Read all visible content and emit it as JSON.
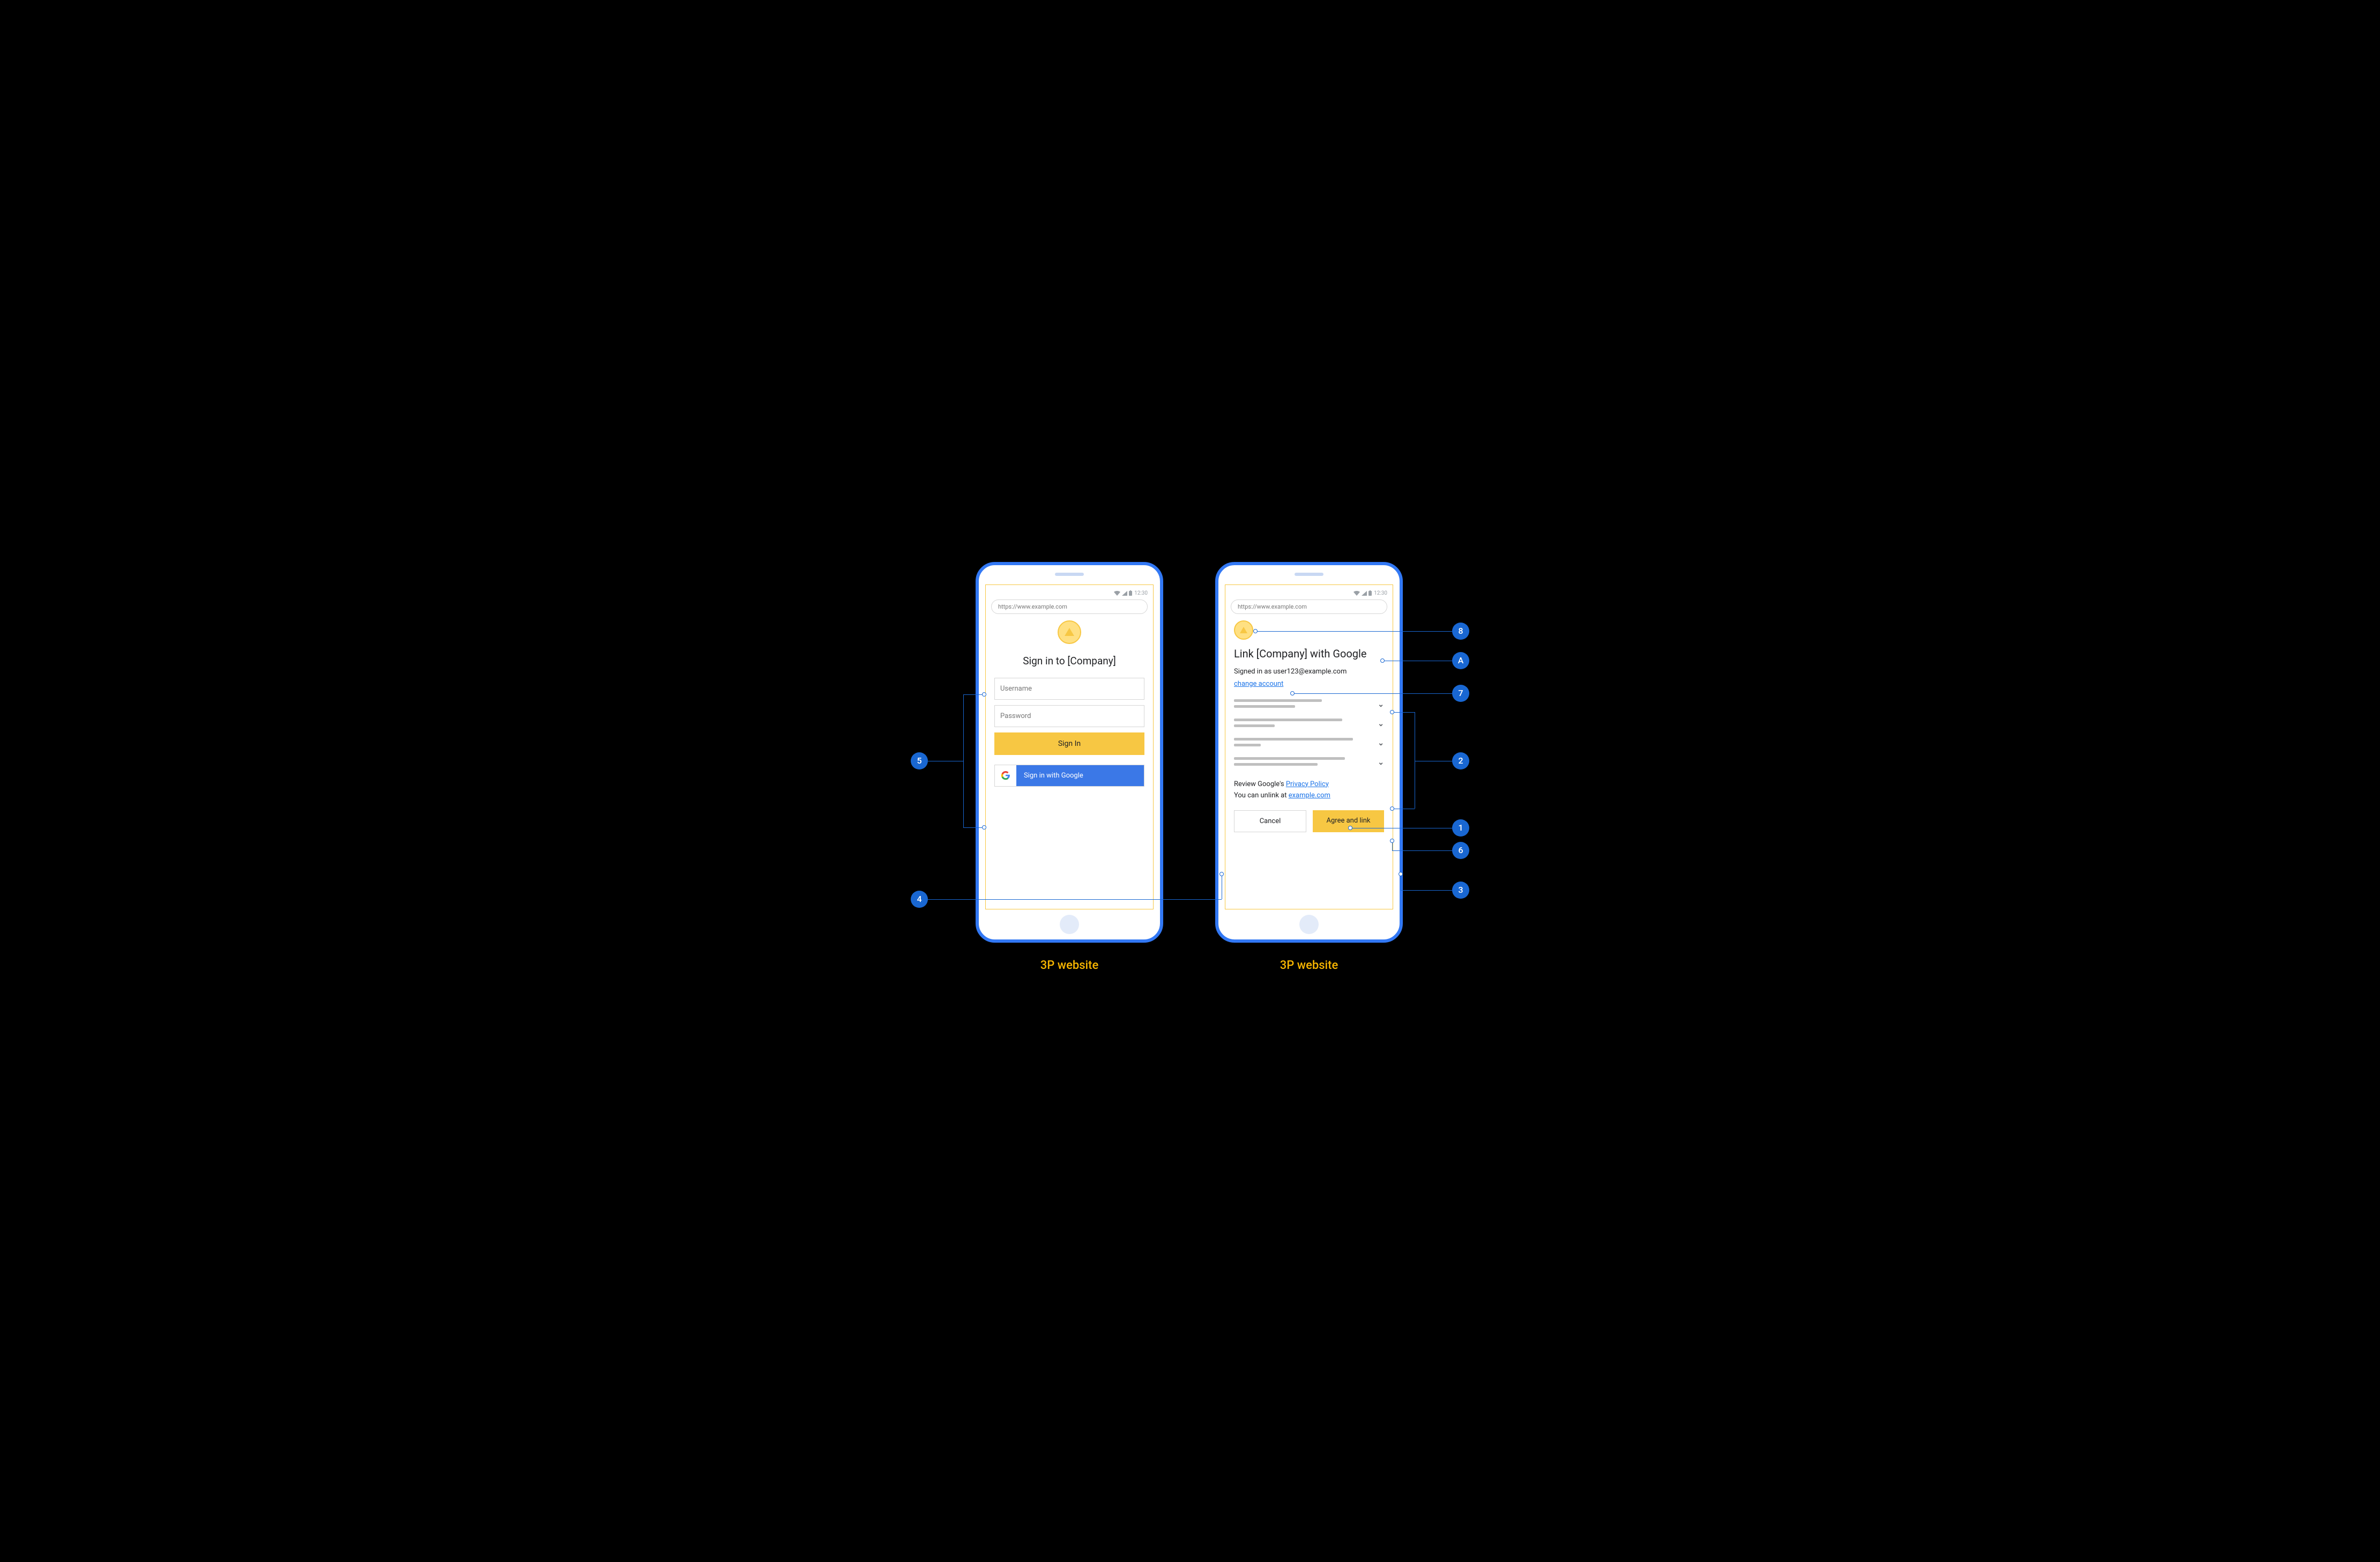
{
  "status": {
    "time": "12:30"
  },
  "url": "https://www.example.com",
  "phoneLeft": {
    "title": "Sign in to [Company]",
    "usernamePlaceholder": "Username",
    "passwordPlaceholder": "Password",
    "signInLabel": "Sign In",
    "googleLabel": "Sign in with Google"
  },
  "phoneRight": {
    "title": "Link [Company] with Google",
    "signedIn": "Signed in as user123@example.com",
    "changeAccount": "change account",
    "policyPrefix": "Review Google's ",
    "policyLink": "Privacy Policy",
    "unlinkPrefix": "You can unlink at ",
    "unlinkLink": "example.com",
    "cancel": "Cancel",
    "agree": "Agree and link"
  },
  "captions": {
    "left": "3P website",
    "right": "3P website"
  },
  "callouts": {
    "c1": "1",
    "c2": "2",
    "c3": "3",
    "c4": "4",
    "c5": "5",
    "c6": "6",
    "c7": "7",
    "c8": "8",
    "cA": "A"
  }
}
